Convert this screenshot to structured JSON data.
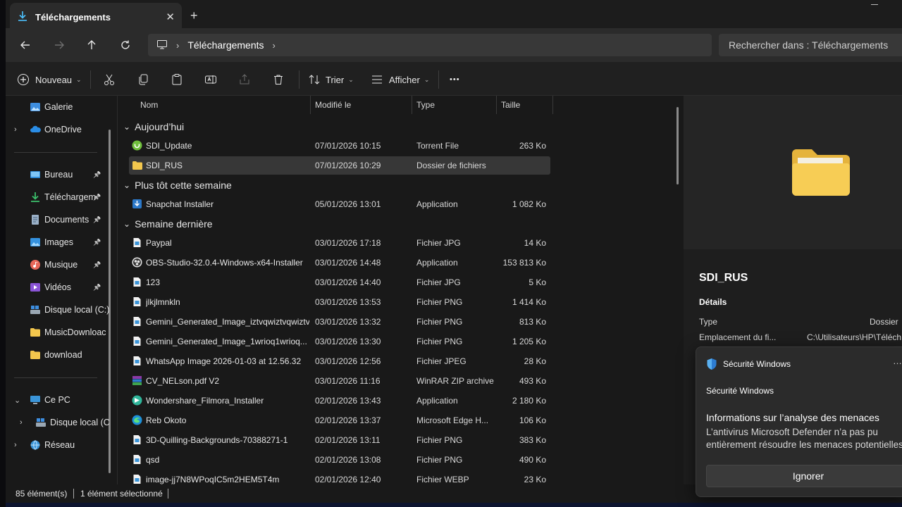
{
  "tab": {
    "title": "Téléchargements",
    "close": "✕",
    "new_tab": "+"
  },
  "address": {
    "crumb": "Téléchargements",
    "search_placeholder": "Rechercher dans : Téléchargements"
  },
  "toolbar": {
    "new_label": "Nouveau",
    "sort_label": "Trier",
    "view_label": "Afficher",
    "more_label": "•••"
  },
  "nav": {
    "items": [
      {
        "label": "Galerie",
        "icon": "gallery-icon",
        "pinned": false,
        "expandable": false
      },
      {
        "label": "OneDrive",
        "icon": "onedrive-icon",
        "pinned": false,
        "expandable": true
      },
      {
        "label": "Bureau",
        "icon": "desktop-icon",
        "pinned": true,
        "expandable": false
      },
      {
        "label": "Téléchargem",
        "icon": "download-icon",
        "pinned": true,
        "expandable": false
      },
      {
        "label": "Documents",
        "icon": "documents-icon",
        "pinned": true,
        "expandable": false
      },
      {
        "label": "Images",
        "icon": "pictures-icon",
        "pinned": true,
        "expandable": false
      },
      {
        "label": "Musique",
        "icon": "music-icon",
        "pinned": true,
        "expandable": false
      },
      {
        "label": "Vidéos",
        "icon": "videos-icon",
        "pinned": true,
        "expandable": false
      },
      {
        "label": "Disque local (C:)",
        "icon": "drive-icon",
        "pinned": false,
        "expandable": false
      },
      {
        "label": "MusicDownloac",
        "icon": "folder-icon",
        "pinned": false,
        "expandable": false
      },
      {
        "label": "download",
        "icon": "folder-icon",
        "pinned": false,
        "expandable": false
      },
      {
        "label": "Ce PC",
        "icon": "pc-icon",
        "pinned": false,
        "expandable": true
      },
      {
        "label": "Disque local (C",
        "icon": "drive-icon",
        "pinned": false,
        "expandable": true
      },
      {
        "label": "Réseau",
        "icon": "network-icon",
        "pinned": false,
        "expandable": true
      }
    ]
  },
  "columns": {
    "name": "Nom",
    "modified": "Modifié le",
    "type": "Type",
    "size": "Taille"
  },
  "groups": [
    {
      "label": "Aujourd’hui"
    },
    {
      "label": "Plus tôt cette semaine"
    },
    {
      "label": "Semaine dernière"
    }
  ],
  "files": [
    {
      "name": "SDI_Update",
      "modified": "07/01/2026 10:15",
      "type": "Torrent File",
      "size": "263 Ko",
      "icon": "torrent-icon"
    },
    {
      "name": "SDI_RUS",
      "modified": "07/01/2026 10:29",
      "type": "Dossier de fichiers",
      "size": "",
      "icon": "folder-icon"
    },
    {
      "name": "Snapchat Installer",
      "modified": "05/01/2026 13:01",
      "type": "Application",
      "size": "1 082 Ko",
      "icon": "installer-icon"
    },
    {
      "name": "Paypal",
      "modified": "03/01/2026 17:18",
      "type": "Fichier JPG",
      "size": "14 Ko",
      "icon": "image-file-icon"
    },
    {
      "name": "OBS-Studio-32.0.4-Windows-x64-Installer",
      "modified": "03/01/2026 14:48",
      "type": "Application",
      "size": "153 813 Ko",
      "icon": "obs-icon"
    },
    {
      "name": "123",
      "modified": "03/01/2026 14:40",
      "type": "Fichier JPG",
      "size": "5 Ko",
      "icon": "image-file-icon"
    },
    {
      "name": "jlkjlmnkln",
      "modified": "03/01/2026 13:53",
      "type": "Fichier PNG",
      "size": "1 414 Ko",
      "icon": "image-file-icon"
    },
    {
      "name": "Gemini_Generated_Image_iztvqwiztvqwiztv",
      "modified": "03/01/2026 13:32",
      "type": "Fichier PNG",
      "size": "813 Ko",
      "icon": "image-file-icon"
    },
    {
      "name": "Gemini_Generated_Image_1wrioq1wrioq...",
      "modified": "03/01/2026 13:30",
      "type": "Fichier PNG",
      "size": "1 205 Ko",
      "icon": "image-file-icon"
    },
    {
      "name": "WhatsApp Image 2026-01-03 at 12.56.32",
      "modified": "03/01/2026 12:56",
      "type": "Fichier JPEG",
      "size": "28 Ko",
      "icon": "image-file-icon"
    },
    {
      "name": "CV_NELson.pdf V2",
      "modified": "03/01/2026 11:16",
      "type": "WinRAR ZIP archive",
      "size": "493 Ko",
      "icon": "winrar-icon"
    },
    {
      "name": "Wondershare_Filmora_Installer",
      "modified": "02/01/2026 13:43",
      "type": "Application",
      "size": "2 180 Ko",
      "icon": "filmora-icon"
    },
    {
      "name": "Reb Okoto",
      "modified": "02/01/2026 13:37",
      "type": "Microsoft Edge H...",
      "size": "106 Ko",
      "icon": "edge-icon"
    },
    {
      "name": "3D-Quilling-Backgrounds-70388271-1",
      "modified": "02/01/2026 13:11",
      "type": "Fichier PNG",
      "size": "383 Ko",
      "icon": "image-file-icon"
    },
    {
      "name": "qsd",
      "modified": "02/01/2026 13:08",
      "type": "Fichier PNG",
      "size": "490 Ko",
      "icon": "image-file-icon"
    },
    {
      "name": "image-jj7N8WPoqIC5m2HEM5T4m",
      "modified": "02/01/2026 12:40",
      "type": "Fichier WEBP",
      "size": "23 Ko",
      "icon": "image-file-icon"
    }
  ],
  "details": {
    "title": "SDI_RUS",
    "section": "Détails",
    "rows": [
      {
        "key": "Type",
        "value": "Dossier"
      },
      {
        "key": "Emplacement du fi...",
        "value": "C:\\Utilisateurs\\HP\\Téléch"
      }
    ]
  },
  "status": {
    "count": "85 élément(s)",
    "selected": "1 élément sélectionné"
  },
  "toast": {
    "app": "Sécurité Windows",
    "source": "Sécurité Windows",
    "heading": "Informations sur l’analyse des menaces",
    "body": "L’antivirus Microsoft Defender n’a pas pu entièrement résoudre les menaces potentielles.",
    "button": "Ignorer",
    "more": "…"
  },
  "colors": {
    "accent": "#4cc2ff",
    "folder": "#f3c74d",
    "selection": "#373737"
  }
}
